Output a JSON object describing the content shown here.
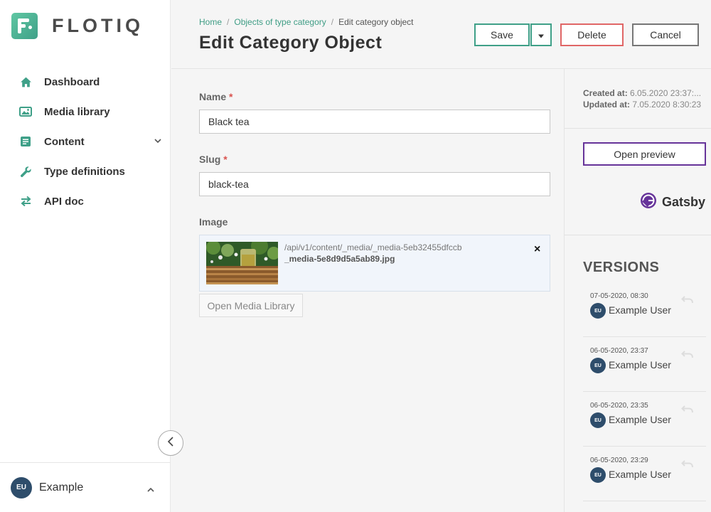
{
  "brand": {
    "name": "FLOTIQ"
  },
  "sidebar": {
    "items": [
      {
        "label": "Dashboard",
        "icon": "home-icon"
      },
      {
        "label": "Media library",
        "icon": "image-icon"
      },
      {
        "label": "Content",
        "icon": "content-icon"
      },
      {
        "label": "Type definitions",
        "icon": "wrench-icon"
      },
      {
        "label": "API doc",
        "icon": "swap-arrows-icon"
      }
    ],
    "user": {
      "initials": "EU",
      "name": "Example"
    }
  },
  "header": {
    "breadcrumb": [
      "Home",
      "Objects of type category",
      "Edit category object"
    ],
    "title": "Edit Category Object",
    "buttons": {
      "save": "Save",
      "delete": "Delete",
      "cancel": "Cancel"
    }
  },
  "form": {
    "name": {
      "label": "Name",
      "required_mark": "*",
      "value": "Black tea"
    },
    "slug": {
      "label": "Slug",
      "required_mark": "*",
      "value": "black-tea"
    },
    "image": {
      "label": "Image",
      "path": "/api/v1/content/_media/_media-5eb32455dfccb",
      "filename": "_media-5e8d9d5a5ab89.jpg",
      "remove_symbol": "×"
    },
    "open_media_library": "Open Media Library"
  },
  "meta": {
    "created_label": "Created at:",
    "created_value": "6.05.2020 23:37:...",
    "updated_label": "Updated at:",
    "updated_value": "7.05.2020 8:30:23"
  },
  "preview": {
    "button": "Open preview",
    "provider": "Gatsby"
  },
  "versions": {
    "title": "VERSIONS",
    "items": [
      {
        "date": "07-05-2020, 08:30",
        "initials": "EU",
        "user": "Example User"
      },
      {
        "date": "06-05-2020, 23:37",
        "initials": "EU",
        "user": "Example User"
      },
      {
        "date": "06-05-2020, 23:35",
        "initials": "EU",
        "user": "Example User"
      },
      {
        "date": "06-05-2020, 23:29",
        "initials": "EU",
        "user": "Example User"
      }
    ]
  },
  "colors": {
    "accent": "#3fa088",
    "danger": "#e06666",
    "gatsby": "#663399",
    "avatar": "#2e4d6b"
  }
}
